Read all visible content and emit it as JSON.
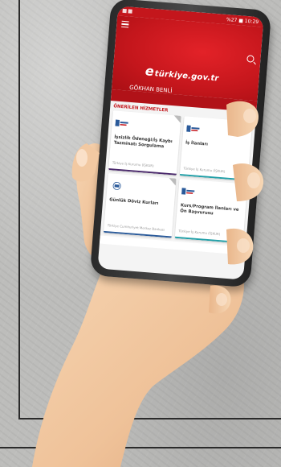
{
  "statusbar": {
    "right_text": "%27 ■ 10:29"
  },
  "app": {
    "logo_text": "türkiye.gov.tr",
    "logo_mark": "e",
    "user_name": "GÖKHAN BENLİ",
    "section_title": "ÖNERİLEN HİZMETLER"
  },
  "cards": [
    {
      "title": "İşsizlik Ödeneği/İş Kaybı Tazminatı Sorgulama",
      "org": "Türkiye İş Kurumu (İŞKUR)",
      "logo": "iskur-logo"
    },
    {
      "title": "İş İlanları",
      "org": "Türkiye İş Kurumu (İŞKUR)",
      "logo": "iskur-logo"
    },
    {
      "title": "Günlük Döviz Kurları",
      "org": "Türkiye Cumhuriyet Merkez Bankası",
      "logo": "tcmb-logo"
    },
    {
      "title": "Kurs/Program İlanları ve Ön Başvurusu",
      "org": "Türkiye İş Kurumu (İŞKUR)",
      "logo": "iskur-logo"
    }
  ],
  "colors": {
    "brand_red": "#c4161c",
    "wall": "#bdbdbb",
    "skin": "#f2c9a2"
  }
}
